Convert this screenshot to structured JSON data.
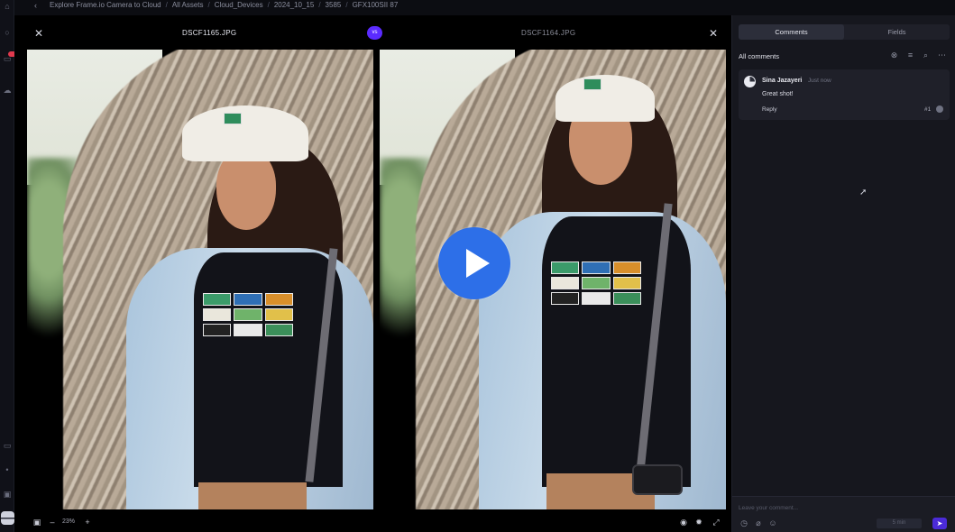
{
  "breadcrumb": {
    "items": [
      "Explore Frame.io Camera to Cloud",
      "All Assets",
      "Cloud_Devices",
      "2024_10_15",
      "3585",
      "GFX100SII 87"
    ],
    "separator": "/"
  },
  "viewer": {
    "left_filename": "DSCF1165.JPG",
    "right_filename": "DSCF1164.JPG",
    "vs_label": "vs",
    "zoom": "23%"
  },
  "panel": {
    "tabs": [
      {
        "label": "Comments",
        "active": true
      },
      {
        "label": "Fields",
        "active": false
      }
    ],
    "title": "All comments",
    "comments": [
      {
        "author": "Sina Jazayeri",
        "time": "Just now",
        "text": "Great shot!",
        "reply_label": "Reply",
        "frame": "#1"
      }
    ],
    "composer": {
      "placeholder": "Leave your comment...",
      "send_hint": "5 min"
    }
  },
  "colors": {
    "accent": "#5b2bff",
    "play": "#2d6fe8",
    "panel_bg": "#16171e"
  }
}
